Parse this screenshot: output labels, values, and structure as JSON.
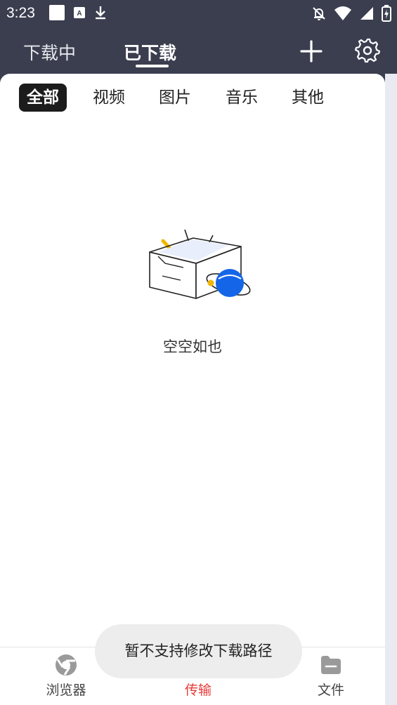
{
  "status_bar": {
    "time": "3:23"
  },
  "header": {
    "tabs": [
      {
        "label": "下载中",
        "active": false
      },
      {
        "label": "已下载",
        "active": true
      }
    ]
  },
  "filters": {
    "items": [
      {
        "label": "全部",
        "active": true
      },
      {
        "label": "视频",
        "active": false
      },
      {
        "label": "图片",
        "active": false
      },
      {
        "label": "音乐",
        "active": false
      },
      {
        "label": "其他",
        "active": false
      }
    ]
  },
  "empty_state": {
    "text": "空空如也"
  },
  "bottom_nav": {
    "items": [
      {
        "label": "浏览器",
        "icon": "browser-icon",
        "active": false
      },
      {
        "label": "传输",
        "icon": "transfer-icon",
        "active": true
      },
      {
        "label": "文件",
        "icon": "file-icon",
        "active": false
      }
    ]
  },
  "toast": {
    "text": "暂不支持修改下载路径"
  },
  "colors": {
    "header_bg": "#3a3e4f",
    "active_chip_bg": "#1c1c1c",
    "active_nav": "#e53935",
    "accent_blue": "#1565e8"
  }
}
